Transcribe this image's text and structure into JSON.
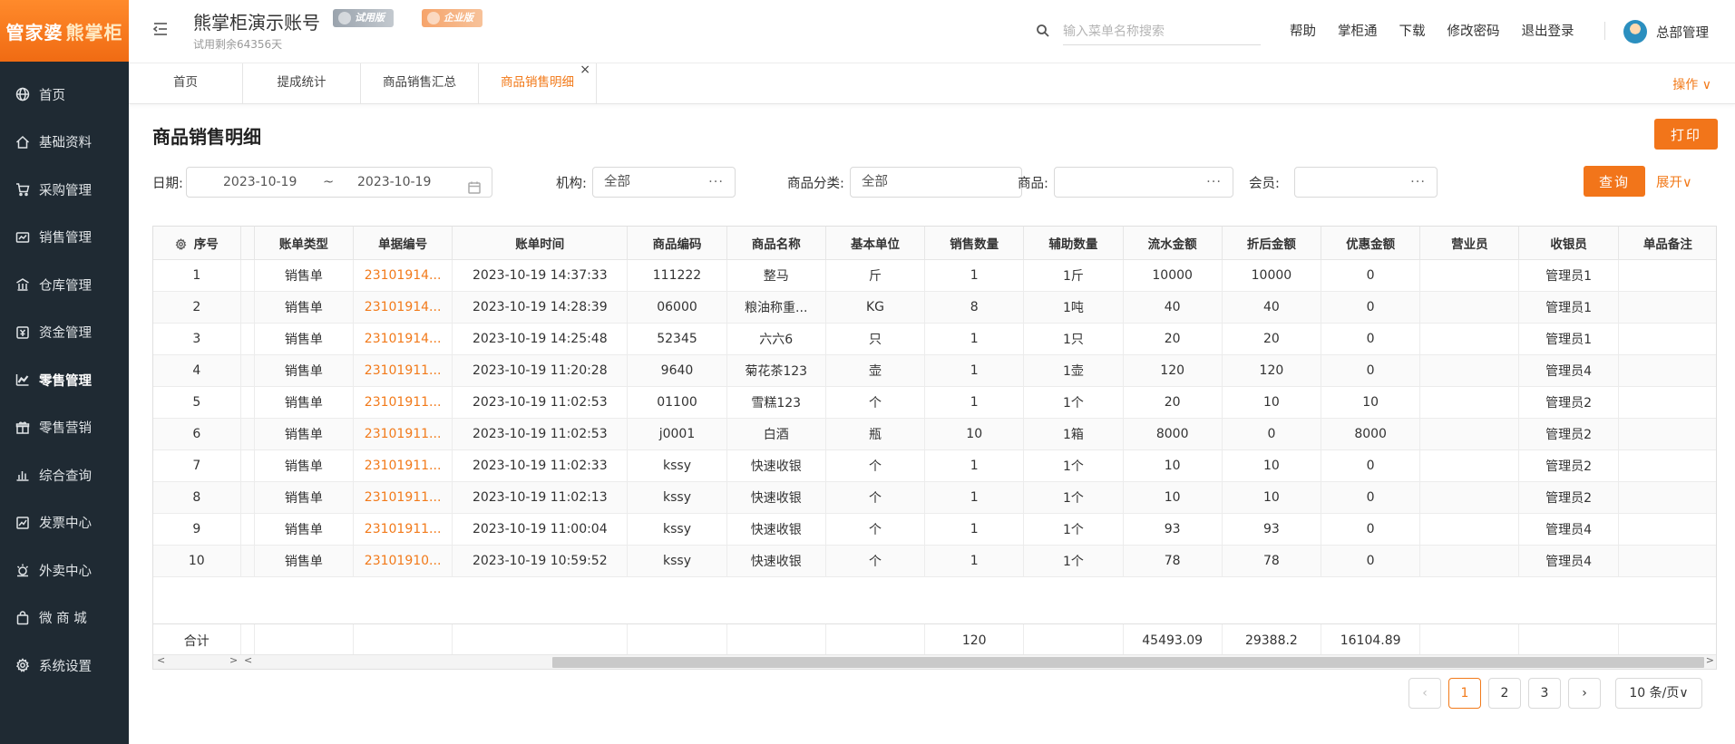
{
  "brand": {
    "logo_main": "管家婆",
    "logo_accent": "熊掌柜",
    "primary_color": "#f27a1a",
    "sidebar_bg": "#1f2a33"
  },
  "header": {
    "account_title": "熊掌柜演示账号",
    "trial_remaining": "试用剩余64356天",
    "badge_trial": "试用版",
    "badge_enterprise": "企业版",
    "search_placeholder": "输入菜单名称搜索",
    "links": [
      "帮助",
      "掌柜通",
      "下载",
      "修改密码",
      "退出登录"
    ],
    "user_name": "总部管理"
  },
  "sidebar": {
    "items": [
      {
        "label": "首页",
        "icon": "globe-icon"
      },
      {
        "label": "基础资料",
        "icon": "home-icon"
      },
      {
        "label": "采购管理",
        "icon": "cart-icon"
      },
      {
        "label": "销售管理",
        "icon": "sales-icon"
      },
      {
        "label": "仓库管理",
        "icon": "warehouse-icon"
      },
      {
        "label": "资金管理",
        "icon": "money-icon"
      },
      {
        "label": "零售管理",
        "icon": "chart-icon"
      },
      {
        "label": "零售营销",
        "icon": "gift-icon"
      },
      {
        "label": "综合查询",
        "icon": "bar-chart-icon"
      },
      {
        "label": "发票中心",
        "icon": "invoice-icon"
      },
      {
        "label": "外卖中心",
        "icon": "delivery-icon"
      },
      {
        "label": "微 商 城",
        "icon": "bag-icon"
      },
      {
        "label": "系统设置",
        "icon": "gear-icon"
      }
    ],
    "active_index": 6
  },
  "tabs": {
    "items": [
      "首页",
      "提成统计",
      "商品销售汇总",
      "商品销售明细"
    ],
    "active_index": 3,
    "close_symbol": "×",
    "ops_label": "操作 ∨"
  },
  "page": {
    "title": "商品销售明细",
    "print_label": "打印",
    "query_label": "查询",
    "expand_label": "展开∨"
  },
  "filters": {
    "date_label": "日期",
    "date_start": "2023-10-19",
    "date_sep": "~",
    "date_end": "2023-10-19",
    "org_label": "机构",
    "org_value": "全部",
    "category_label": "商品分类",
    "category_value": "全部",
    "product_label": "商品",
    "product_value": "",
    "member_label": "会员",
    "member_value": "",
    "dots": "···"
  },
  "table": {
    "columns": [
      "序号",
      "账单类型",
      "单据编号",
      "账单时间",
      "商品编码",
      "商品名称",
      "基本单位",
      "销售数量",
      "辅助数量",
      "流水金额",
      "折后金额",
      "优惠金额",
      "营业员",
      "收银员",
      "单品备注"
    ],
    "rows": [
      [
        "1",
        "销售单",
        "23101914...",
        "2023-10-19 14:37:33",
        "111222",
        "整马",
        "斤",
        "1",
        "1斤",
        "10000",
        "10000",
        "0",
        "",
        "管理员1",
        ""
      ],
      [
        "2",
        "销售单",
        "23101914...",
        "2023-10-19 14:28:39",
        "06000",
        "粮油称重...",
        "KG",
        "8",
        "1吨",
        "40",
        "40",
        "0",
        "",
        "管理员1",
        ""
      ],
      [
        "3",
        "销售单",
        "23101914...",
        "2023-10-19 14:25:48",
        "52345",
        "六六6",
        "只",
        "1",
        "1只",
        "20",
        "20",
        "0",
        "",
        "管理员1",
        ""
      ],
      [
        "4",
        "销售单",
        "23101911...",
        "2023-10-19 11:20:28",
        "9640",
        "菊花茶123",
        "壶",
        "1",
        "1壶",
        "120",
        "120",
        "0",
        "",
        "管理员4",
        ""
      ],
      [
        "5",
        "销售单",
        "23101911...",
        "2023-10-19 11:02:53",
        "01100",
        "雪糕123",
        "个",
        "1",
        "1个",
        "20",
        "10",
        "10",
        "",
        "管理员2",
        ""
      ],
      [
        "6",
        "销售单",
        "23101911...",
        "2023-10-19 11:02:53",
        "j0001",
        "白酒",
        "瓶",
        "10",
        "1箱",
        "8000",
        "0",
        "8000",
        "",
        "管理员2",
        ""
      ],
      [
        "7",
        "销售单",
        "23101911...",
        "2023-10-19 11:02:33",
        "kssy",
        "快速收银",
        "个",
        "1",
        "1个",
        "10",
        "10",
        "0",
        "",
        "管理员2",
        ""
      ],
      [
        "8",
        "销售单",
        "23101911...",
        "2023-10-19 11:02:13",
        "kssy",
        "快速收银",
        "个",
        "1",
        "1个",
        "10",
        "10",
        "0",
        "",
        "管理员2",
        ""
      ],
      [
        "9",
        "销售单",
        "23101911...",
        "2023-10-19 11:00:04",
        "kssy",
        "快速收银",
        "个",
        "1",
        "1个",
        "93",
        "93",
        "0",
        "",
        "管理员4",
        ""
      ],
      [
        "10",
        "销售单",
        "23101910...",
        "2023-10-19 10:59:52",
        "kssy",
        "快速收银",
        "个",
        "1",
        "1个",
        "78",
        "78",
        "0",
        "",
        "管理员4",
        ""
      ]
    ],
    "summary": [
      "合计",
      "",
      "",
      "",
      "",
      "",
      "",
      "120",
      "",
      "45493.09",
      "29388.2",
      "16104.89",
      "",
      "",
      ""
    ]
  },
  "pagination": {
    "prev": "‹",
    "pages": [
      "1",
      "2",
      "3"
    ],
    "current": "1",
    "next": "›",
    "page_size": "10 条/页∨"
  }
}
